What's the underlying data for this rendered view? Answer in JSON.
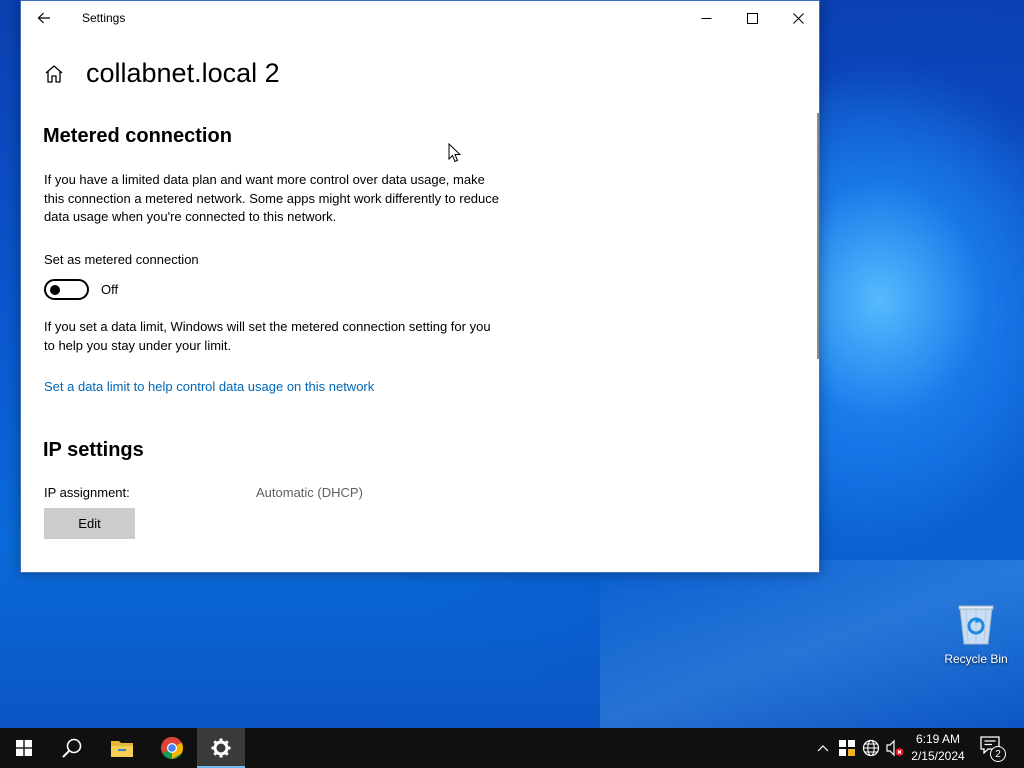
{
  "window": {
    "title": "Settings",
    "page_title": "collabnet.local 2"
  },
  "metered": {
    "heading": "Metered connection",
    "description": "If you have a limited data plan and want more control over data usage, make this connection a metered network. Some apps might work differently to reduce data usage when you're connected to this network.",
    "toggle_label": "Set as metered connection",
    "toggle_state": "Off",
    "toggle_on": false,
    "limit_text": "If you set a data limit, Windows will set the metered connection setting for you to help you stay under your limit.",
    "limit_link": "Set a data limit to help control data usage on this network"
  },
  "ip": {
    "heading": "IP settings",
    "assignment_label": "IP assignment:",
    "assignment_value": "Automatic (DHCP)",
    "edit_label": "Edit"
  },
  "desktop": {
    "recycle_bin_label": "Recycle Bin"
  },
  "taskbar": {
    "items": [
      "start-icon",
      "search-icon",
      "file-explorer-icon",
      "chrome-icon",
      "settings-icon"
    ],
    "active_item": "settings-icon",
    "time": "6:19 AM",
    "date": "2/15/2024",
    "notification_count": "2"
  },
  "colors": {
    "link": "#0067b8",
    "edit_button": "#cccccc",
    "taskbar": "#101010",
    "active_indicator": "#76b9ed"
  }
}
